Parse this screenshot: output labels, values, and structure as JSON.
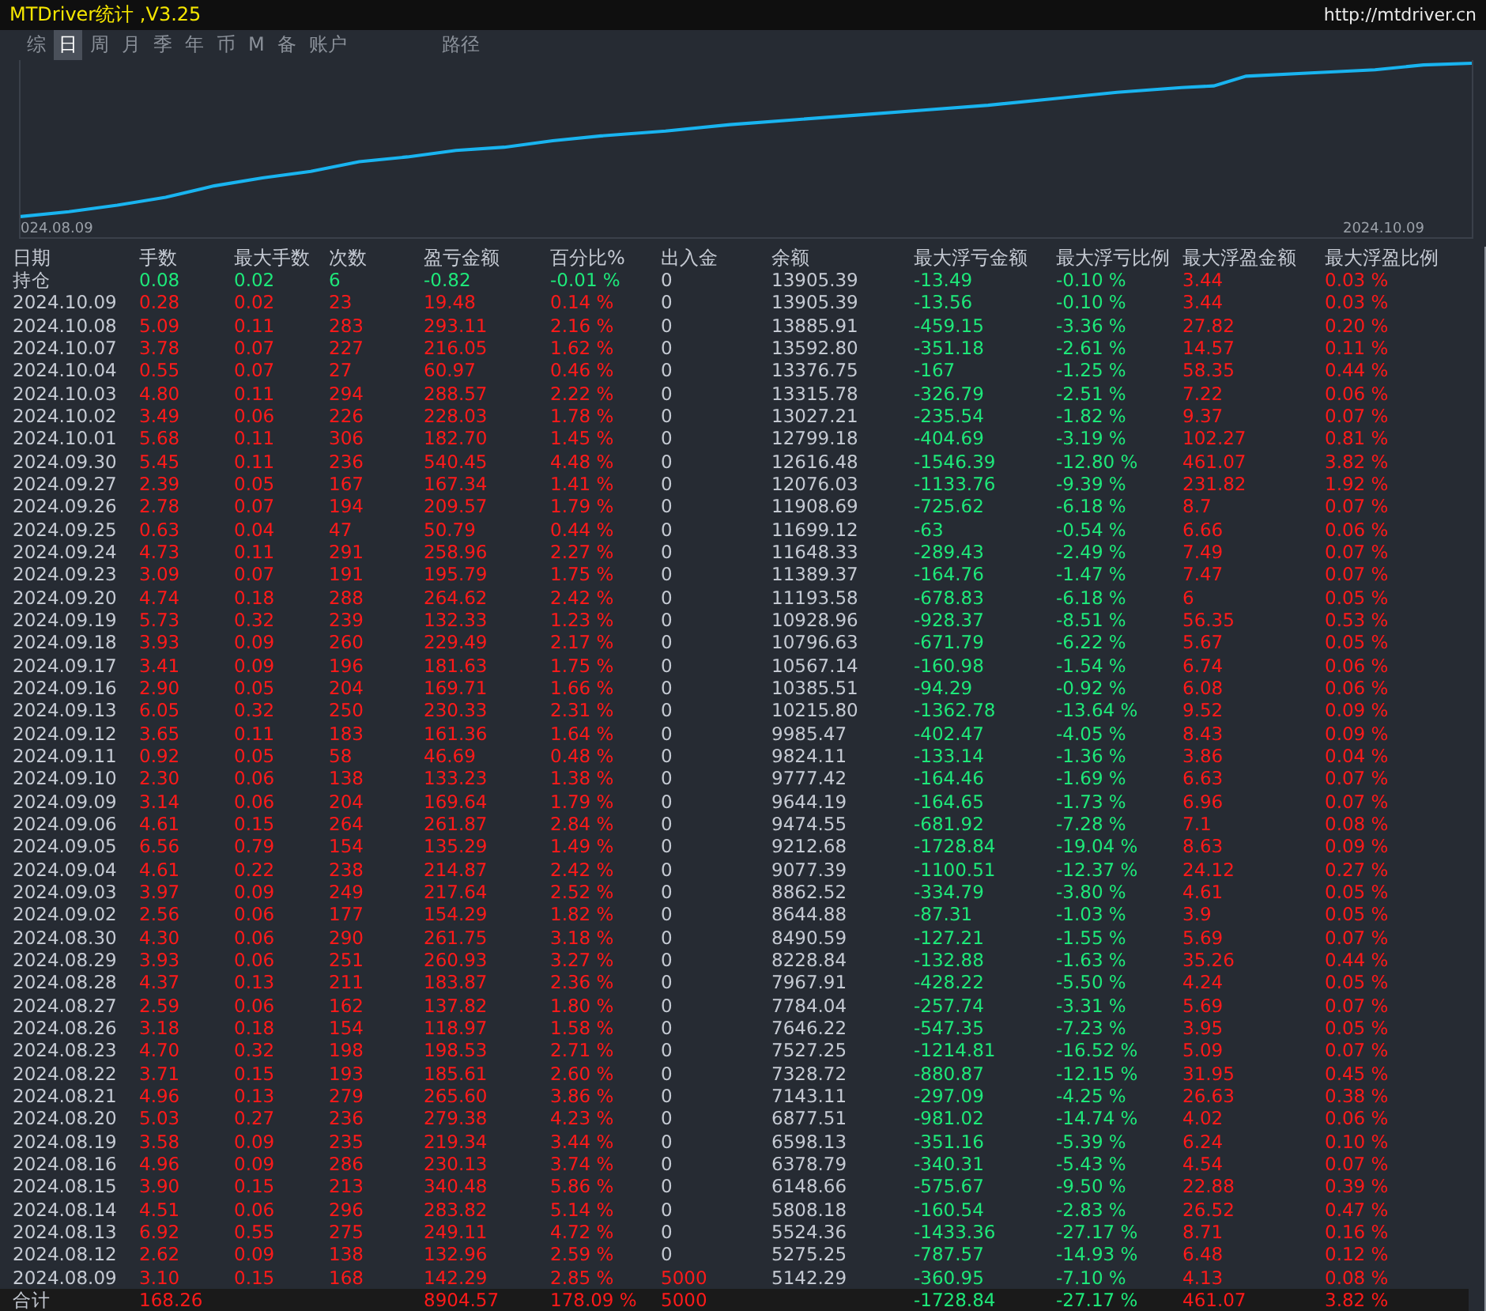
{
  "window": {
    "title": "MTDriver统计 ,V3.25",
    "link": "http://mtdriver.cn"
  },
  "tabs": [
    {
      "label": "综",
      "selected": false
    },
    {
      "label": "日",
      "selected": true
    },
    {
      "label": "周",
      "selected": false
    },
    {
      "label": "月",
      "selected": false
    },
    {
      "label": "季",
      "selected": false
    },
    {
      "label": "年",
      "selected": false
    },
    {
      "label": "币",
      "selected": false
    },
    {
      "label": "M",
      "selected": false
    },
    {
      "label": "备",
      "selected": false
    },
    {
      "label": "账户",
      "selected": false
    },
    {
      "label": "路径",
      "selected": false
    }
  ],
  "chart": {
    "start_label": "024.08.09",
    "end_label": "2024.10.09"
  },
  "table": {
    "columns": [
      {
        "label": "日期",
        "kind": "plain"
      },
      {
        "label": "手数",
        "kind": "gain"
      },
      {
        "label": "最大手数",
        "kind": "gain"
      },
      {
        "label": "次数",
        "kind": "gain"
      },
      {
        "label": "盈亏金额",
        "kind": "gain"
      },
      {
        "label": "百分比%",
        "kind": "gain"
      },
      {
        "label": "出入金",
        "kind": "flow"
      },
      {
        "label": "余额",
        "kind": "plain"
      },
      {
        "label": "最大浮亏金额",
        "kind": "loss"
      },
      {
        "label": "最大浮亏比例",
        "kind": "loss"
      },
      {
        "label": "最大浮盈金额",
        "kind": "profit"
      },
      {
        "label": "最大浮盈比例",
        "kind": "profit"
      }
    ],
    "rows": [
      {
        "kind": "position",
        "cells": [
          "持仓",
          "0.08",
          "0.02",
          "6",
          "-0.82",
          "-0.01 %",
          "0",
          "13905.39",
          "-13.49",
          "-0.10 %",
          "3.44",
          "0.03 %"
        ]
      },
      {
        "kind": "day",
        "cells": [
          "2024.10.09",
          "0.28",
          "0.02",
          "23",
          "19.48",
          "0.14 %",
          "0",
          "13905.39",
          "-13.56",
          "-0.10 %",
          "3.44",
          "0.03 %"
        ]
      },
      {
        "kind": "day",
        "cells": [
          "2024.10.08",
          "5.09",
          "0.11",
          "283",
          "293.11",
          "2.16 %",
          "0",
          "13885.91",
          "-459.15",
          "-3.36 %",
          "27.82",
          "0.20 %"
        ]
      },
      {
        "kind": "day",
        "cells": [
          "2024.10.07",
          "3.78",
          "0.07",
          "227",
          "216.05",
          "1.62 %",
          "0",
          "13592.80",
          "-351.18",
          "-2.61 %",
          "14.57",
          "0.11 %"
        ]
      },
      {
        "kind": "day",
        "cells": [
          "2024.10.04",
          "0.55",
          "0.07",
          "27",
          "60.97",
          "0.46 %",
          "0",
          "13376.75",
          "-167",
          "-1.25 %",
          "58.35",
          "0.44 %"
        ]
      },
      {
        "kind": "day",
        "cells": [
          "2024.10.03",
          "4.80",
          "0.11",
          "294",
          "288.57",
          "2.22 %",
          "0",
          "13315.78",
          "-326.79",
          "-2.51 %",
          "7.22",
          "0.06 %"
        ]
      },
      {
        "kind": "day",
        "cells": [
          "2024.10.02",
          "3.49",
          "0.06",
          "226",
          "228.03",
          "1.78 %",
          "0",
          "13027.21",
          "-235.54",
          "-1.82 %",
          "9.37",
          "0.07 %"
        ]
      },
      {
        "kind": "day",
        "cells": [
          "2024.10.01",
          "5.68",
          "0.11",
          "306",
          "182.70",
          "1.45 %",
          "0",
          "12799.18",
          "-404.69",
          "-3.19 %",
          "102.27",
          "0.81 %"
        ]
      },
      {
        "kind": "day",
        "cells": [
          "2024.09.30",
          "5.45",
          "0.11",
          "236",
          "540.45",
          "4.48 %",
          "0",
          "12616.48",
          "-1546.39",
          "-12.80 %",
          "461.07",
          "3.82 %"
        ]
      },
      {
        "kind": "day",
        "cells": [
          "2024.09.27",
          "2.39",
          "0.05",
          "167",
          "167.34",
          "1.41 %",
          "0",
          "12076.03",
          "-1133.76",
          "-9.39 %",
          "231.82",
          "1.92 %"
        ]
      },
      {
        "kind": "day",
        "cells": [
          "2024.09.26",
          "2.78",
          "0.07",
          "194",
          "209.57",
          "1.79 %",
          "0",
          "11908.69",
          "-725.62",
          "-6.18 %",
          "8.7",
          "0.07 %"
        ]
      },
      {
        "kind": "day",
        "cells": [
          "2024.09.25",
          "0.63",
          "0.04",
          "47",
          "50.79",
          "0.44 %",
          "0",
          "11699.12",
          "-63",
          "-0.54 %",
          "6.66",
          "0.06 %"
        ]
      },
      {
        "kind": "day",
        "cells": [
          "2024.09.24",
          "4.73",
          "0.11",
          "291",
          "258.96",
          "2.27 %",
          "0",
          "11648.33",
          "-289.43",
          "-2.49 %",
          "7.49",
          "0.07 %"
        ]
      },
      {
        "kind": "day",
        "cells": [
          "2024.09.23",
          "3.09",
          "0.07",
          "191",
          "195.79",
          "1.75 %",
          "0",
          "11389.37",
          "-164.76",
          "-1.47 %",
          "7.47",
          "0.07 %"
        ]
      },
      {
        "kind": "day",
        "cells": [
          "2024.09.20",
          "4.74",
          "0.18",
          "288",
          "264.62",
          "2.42 %",
          "0",
          "11193.58",
          "-678.83",
          "-6.18 %",
          "6",
          "0.05 %"
        ]
      },
      {
        "kind": "day",
        "cells": [
          "2024.09.19",
          "5.73",
          "0.32",
          "239",
          "132.33",
          "1.23 %",
          "0",
          "10928.96",
          "-928.37",
          "-8.51 %",
          "56.35",
          "0.53 %"
        ]
      },
      {
        "kind": "day",
        "cells": [
          "2024.09.18",
          "3.93",
          "0.09",
          "260",
          "229.49",
          "2.17 %",
          "0",
          "10796.63",
          "-671.79",
          "-6.22 %",
          "5.67",
          "0.05 %"
        ]
      },
      {
        "kind": "day",
        "cells": [
          "2024.09.17",
          "3.41",
          "0.09",
          "196",
          "181.63",
          "1.75 %",
          "0",
          "10567.14",
          "-160.98",
          "-1.54 %",
          "6.74",
          "0.06 %"
        ]
      },
      {
        "kind": "day",
        "cells": [
          "2024.09.16",
          "2.90",
          "0.05",
          "204",
          "169.71",
          "1.66 %",
          "0",
          "10385.51",
          "-94.29",
          "-0.92 %",
          "6.08",
          "0.06 %"
        ]
      },
      {
        "kind": "day",
        "cells": [
          "2024.09.13",
          "6.05",
          "0.32",
          "250",
          "230.33",
          "2.31 %",
          "0",
          "10215.80",
          "-1362.78",
          "-13.64 %",
          "9.52",
          "0.09 %"
        ]
      },
      {
        "kind": "day",
        "cells": [
          "2024.09.12",
          "3.65",
          "0.11",
          "183",
          "161.36",
          "1.64 %",
          "0",
          "9985.47",
          "-402.47",
          "-4.05 %",
          "8.43",
          "0.09 %"
        ]
      },
      {
        "kind": "day",
        "cells": [
          "2024.09.11",
          "0.92",
          "0.05",
          "58",
          "46.69",
          "0.48 %",
          "0",
          "9824.11",
          "-133.14",
          "-1.36 %",
          "3.86",
          "0.04 %"
        ]
      },
      {
        "kind": "day",
        "cells": [
          "2024.09.10",
          "2.30",
          "0.06",
          "138",
          "133.23",
          "1.38 %",
          "0",
          "9777.42",
          "-164.46",
          "-1.69 %",
          "6.63",
          "0.07 %"
        ]
      },
      {
        "kind": "day",
        "cells": [
          "2024.09.09",
          "3.14",
          "0.06",
          "204",
          "169.64",
          "1.79 %",
          "0",
          "9644.19",
          "-164.65",
          "-1.73 %",
          "6.96",
          "0.07 %"
        ]
      },
      {
        "kind": "day",
        "cells": [
          "2024.09.06",
          "4.61",
          "0.15",
          "264",
          "261.87",
          "2.84 %",
          "0",
          "9474.55",
          "-681.92",
          "-7.28 %",
          "7.1",
          "0.08 %"
        ]
      },
      {
        "kind": "day",
        "cells": [
          "2024.09.05",
          "6.56",
          "0.79",
          "154",
          "135.29",
          "1.49 %",
          "0",
          "9212.68",
          "-1728.84",
          "-19.04 %",
          "8.63",
          "0.09 %"
        ]
      },
      {
        "kind": "day",
        "cells": [
          "2024.09.04",
          "4.61",
          "0.22",
          "238",
          "214.87",
          "2.42 %",
          "0",
          "9077.39",
          "-1100.51",
          "-12.37 %",
          "24.12",
          "0.27 %"
        ]
      },
      {
        "kind": "day",
        "cells": [
          "2024.09.03",
          "3.97",
          "0.09",
          "249",
          "217.64",
          "2.52 %",
          "0",
          "8862.52",
          "-334.79",
          "-3.80 %",
          "4.61",
          "0.05 %"
        ]
      },
      {
        "kind": "day",
        "cells": [
          "2024.09.02",
          "2.56",
          "0.06",
          "177",
          "154.29",
          "1.82 %",
          "0",
          "8644.88",
          "-87.31",
          "-1.03 %",
          "3.9",
          "0.05 %"
        ]
      },
      {
        "kind": "day",
        "cells": [
          "2024.08.30",
          "4.30",
          "0.06",
          "290",
          "261.75",
          "3.18 %",
          "0",
          "8490.59",
          "-127.21",
          "-1.55 %",
          "5.69",
          "0.07 %"
        ]
      },
      {
        "kind": "day",
        "cells": [
          "2024.08.29",
          "3.93",
          "0.06",
          "251",
          "260.93",
          "3.27 %",
          "0",
          "8228.84",
          "-132.88",
          "-1.63 %",
          "35.26",
          "0.44 %"
        ]
      },
      {
        "kind": "day",
        "cells": [
          "2024.08.28",
          "4.37",
          "0.13",
          "211",
          "183.87",
          "2.36 %",
          "0",
          "7967.91",
          "-428.22",
          "-5.50 %",
          "4.24",
          "0.05 %"
        ]
      },
      {
        "kind": "day",
        "cells": [
          "2024.08.27",
          "2.59",
          "0.06",
          "162",
          "137.82",
          "1.80 %",
          "0",
          "7784.04",
          "-257.74",
          "-3.31 %",
          "5.69",
          "0.07 %"
        ]
      },
      {
        "kind": "day",
        "cells": [
          "2024.08.26",
          "3.18",
          "0.18",
          "154",
          "118.97",
          "1.58 %",
          "0",
          "7646.22",
          "-547.35",
          "-7.23 %",
          "3.95",
          "0.05 %"
        ]
      },
      {
        "kind": "day",
        "cells": [
          "2024.08.23",
          "4.70",
          "0.32",
          "198",
          "198.53",
          "2.71 %",
          "0",
          "7527.25",
          "-1214.81",
          "-16.52 %",
          "5.09",
          "0.07 %"
        ]
      },
      {
        "kind": "day",
        "cells": [
          "2024.08.22",
          "3.71",
          "0.15",
          "193",
          "185.61",
          "2.60 %",
          "0",
          "7328.72",
          "-880.87",
          "-12.15 %",
          "31.95",
          "0.45 %"
        ]
      },
      {
        "kind": "day",
        "cells": [
          "2024.08.21",
          "4.96",
          "0.13",
          "279",
          "265.60",
          "3.86 %",
          "0",
          "7143.11",
          "-297.09",
          "-4.25 %",
          "26.63",
          "0.38 %"
        ]
      },
      {
        "kind": "day",
        "cells": [
          "2024.08.20",
          "5.03",
          "0.27",
          "236",
          "279.38",
          "4.23 %",
          "0",
          "6877.51",
          "-981.02",
          "-14.74 %",
          "4.02",
          "0.06 %"
        ]
      },
      {
        "kind": "day",
        "cells": [
          "2024.08.19",
          "3.58",
          "0.09",
          "235",
          "219.34",
          "3.44 %",
          "0",
          "6598.13",
          "-351.16",
          "-5.39 %",
          "6.24",
          "0.10 %"
        ]
      },
      {
        "kind": "day",
        "cells": [
          "2024.08.16",
          "4.96",
          "0.09",
          "286",
          "230.13",
          "3.74 %",
          "0",
          "6378.79",
          "-340.31",
          "-5.43 %",
          "4.54",
          "0.07 %"
        ]
      },
      {
        "kind": "day",
        "cells": [
          "2024.08.15",
          "3.90",
          "0.15",
          "213",
          "340.48",
          "5.86 %",
          "0",
          "6148.66",
          "-575.67",
          "-9.50 %",
          "22.88",
          "0.39 %"
        ]
      },
      {
        "kind": "day",
        "cells": [
          "2024.08.14",
          "4.51",
          "0.06",
          "296",
          "283.82",
          "5.14 %",
          "0",
          "5808.18",
          "-160.54",
          "-2.83 %",
          "26.52",
          "0.47 %"
        ]
      },
      {
        "kind": "day",
        "cells": [
          "2024.08.13",
          "6.92",
          "0.55",
          "275",
          "249.11",
          "4.72 %",
          "0",
          "5524.36",
          "-1433.36",
          "-27.17 %",
          "8.71",
          "0.16 %"
        ]
      },
      {
        "kind": "day",
        "cells": [
          "2024.08.12",
          "2.62",
          "0.09",
          "138",
          "132.96",
          "2.59 %",
          "0",
          "5275.25",
          "-787.57",
          "-14.93 %",
          "6.48",
          "0.12 %"
        ]
      },
      {
        "kind": "day",
        "cells": [
          "2024.08.09",
          "3.10",
          "0.15",
          "168",
          "142.29",
          "2.85 %",
          "5000",
          "5142.29",
          "-360.95",
          "-7.10 %",
          "4.13",
          "0.08 %"
        ]
      },
      {
        "kind": "total",
        "cells": [
          "合计",
          "168.26",
          null,
          null,
          "8904.57",
          "178.09 %",
          "5000",
          null,
          "-1728.84",
          "-27.17 %",
          "461.07",
          "3.82 %"
        ]
      }
    ]
  }
}
